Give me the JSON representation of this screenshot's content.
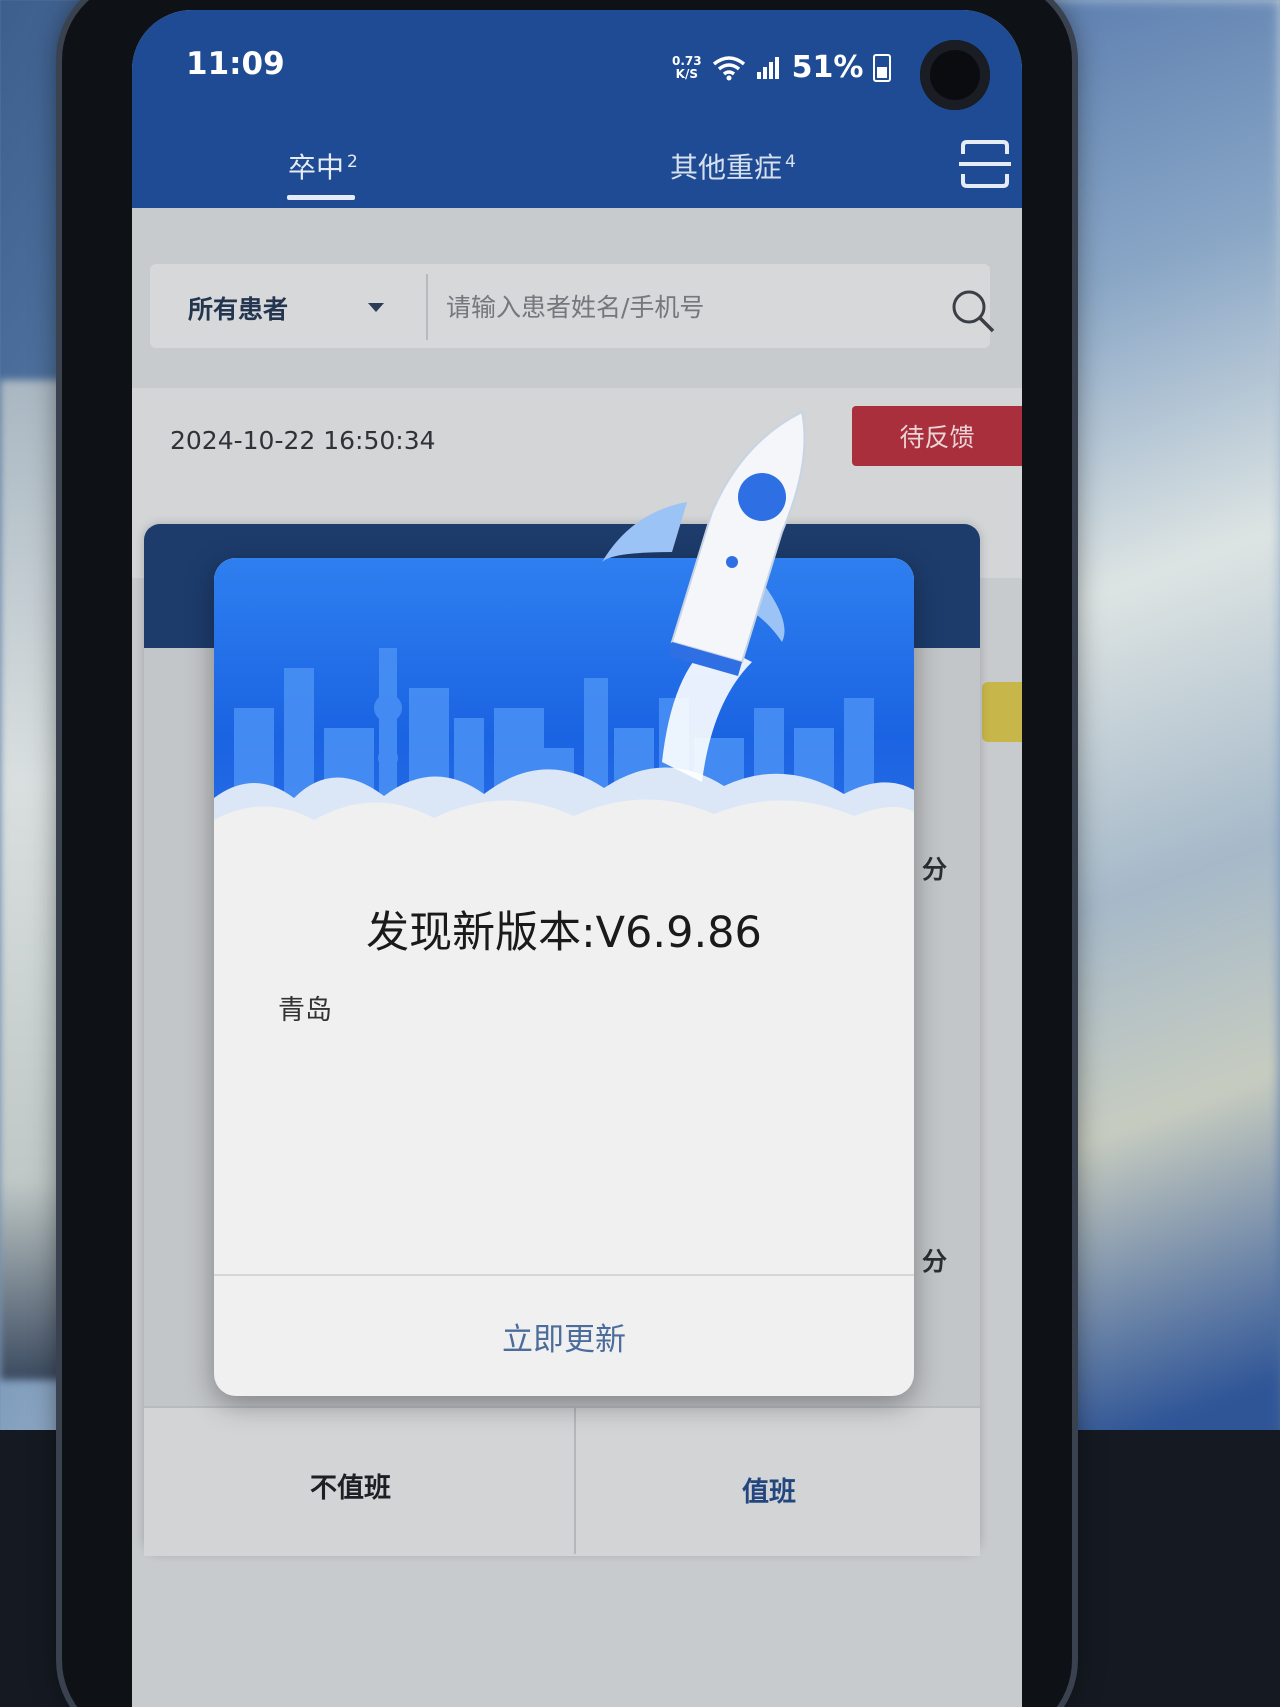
{
  "status_bar": {
    "time": "11:09",
    "net_speed_value": "0.73",
    "net_speed_unit": "K/S",
    "battery": "51%"
  },
  "tabs": [
    {
      "label": "卒中",
      "badge": "2"
    },
    {
      "label": "其他重症",
      "badge": "4"
    }
  ],
  "search": {
    "filter_label": "所有患者",
    "placeholder": "请输入患者姓名/手机号"
  },
  "card": {
    "timestamp": "2024-10-22 16:50:34",
    "status_badge": "待反馈"
  },
  "background_dialog": {
    "score_unit_1": "分",
    "score_unit_2": "分",
    "left_button": "不值班",
    "right_button": "值班"
  },
  "update_modal": {
    "title": "发现新版本:V6.9.86",
    "description": "青岛",
    "update_button": "立即更新"
  },
  "colors": {
    "header_blue": "#1e4b93",
    "badge_red": "#a82f3b",
    "banner_blue": "#1a63e2",
    "button_text": "#4c6d9c"
  }
}
